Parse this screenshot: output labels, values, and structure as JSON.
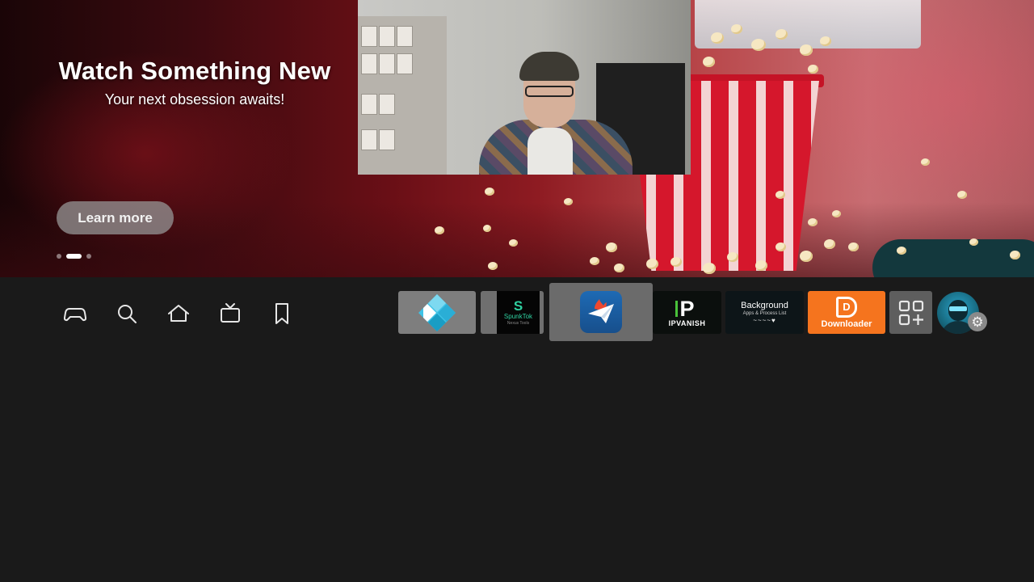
{
  "hero": {
    "title": "Watch Something New",
    "subtitle": "Your next obsession awaits!",
    "cta_label": "Learn more",
    "carousel_pages": 3,
    "carousel_active_index": 1
  },
  "nav": {
    "items": [
      {
        "name": "games",
        "icon": "gamepad-icon"
      },
      {
        "name": "search",
        "icon": "search-icon"
      },
      {
        "name": "home",
        "icon": "home-icon"
      },
      {
        "name": "live-tv",
        "icon": "tv-icon"
      },
      {
        "name": "watchlist",
        "icon": "bookmark-icon"
      }
    ]
  },
  "apps": {
    "kodi": {
      "icon": "kodi-logo-icon"
    },
    "spunktok": {
      "name": "SpunkTok",
      "letter": "S",
      "tagline": "Nexus Tools"
    },
    "focused_app": {
      "icon": "paper-plane-fire-icon"
    },
    "ipvanish": {
      "letter": "P",
      "name": "IPVANISH"
    },
    "background_apps": {
      "title": "Background",
      "subtitle": "Apps & Process List",
      "wave": "~~~~♥"
    },
    "downloader": {
      "letter": "D",
      "name": "Downloader"
    },
    "app_library": {
      "icon": "app-grid-plus-icon"
    }
  },
  "profile": {
    "icon": "profile-avatar-icon",
    "badge_icon": "gear-icon",
    "badge_glyph": "⚙"
  },
  "colors": {
    "background": "#1a1a1a",
    "downloader": "#f5741e",
    "accent_teal": "#2aa3c9"
  }
}
